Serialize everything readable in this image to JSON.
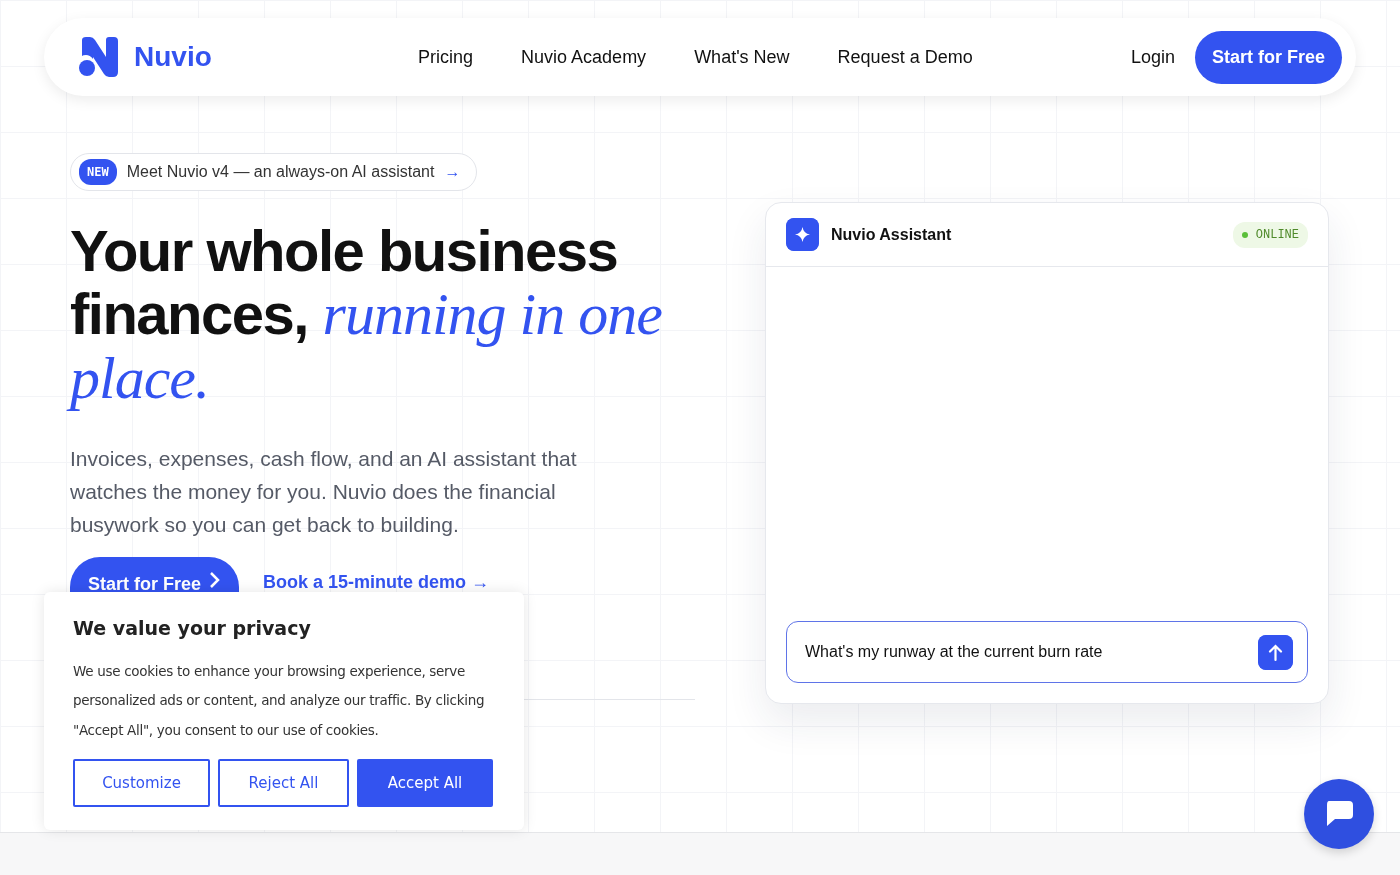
{
  "brand": {
    "name": "Nuvio"
  },
  "nav": {
    "links": [
      "Pricing",
      "Nuvio Academy",
      "What's New",
      "Request a Demo"
    ],
    "login": "Login",
    "cta": "Start for Free"
  },
  "announcement": {
    "badge": "NEW",
    "text": "Meet Nuvio v4 — an always-on AI assistant",
    "arrow": "→"
  },
  "hero": {
    "headline": "Your whole business finances,",
    "accent": "running in one place.",
    "description": "Invoices, expenses, cash flow, and an AI assistant that watches the money for you. Nuvio does the financial busywork so you can get back to building.",
    "primary_button": "Start for Free",
    "demo_link": "Book a 15-minute demo →"
  },
  "assistant": {
    "title": "Nuvio Assistant",
    "status": "ONLINE",
    "online": true,
    "input_value": "What's my runway at the current burn rate"
  },
  "cookie_banner": {
    "title": "We value your privacy",
    "text": "We use cookies to enhance your browsing experience, serve personalized ads or content, and analyze our traffic. By clicking \"Accept All\", you consent to our use of cookies.",
    "buttons": [
      {
        "label": "Customize",
        "kind": "outline"
      },
      {
        "label": "Reject All",
        "kind": "outline"
      },
      {
        "label": "Accept All",
        "kind": "filled"
      }
    ]
  }
}
